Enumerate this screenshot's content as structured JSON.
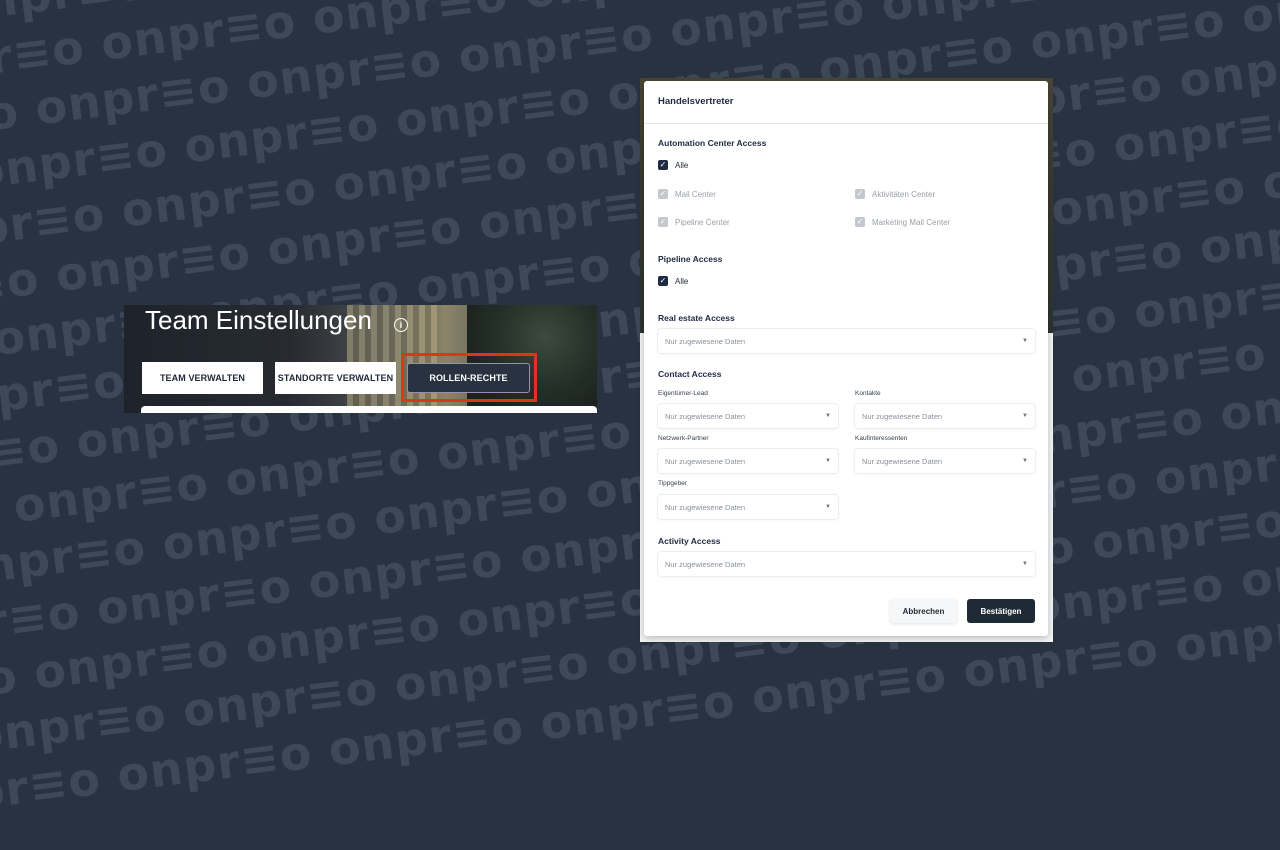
{
  "watermark": {
    "text": "onpr≡o"
  },
  "team_settings": {
    "title": "Team Einstellungen",
    "tabs": [
      {
        "label": "TEAM VERWALTEN"
      },
      {
        "label": "STANDORTE VERWALTEN"
      },
      {
        "label": "ROLLEN-RECHTE"
      }
    ]
  },
  "modal": {
    "title": "Handelsvertreter",
    "automation": {
      "title": "Automation Center Access",
      "all_label": "Alle",
      "items": [
        "Mail Center",
        "Aktivitäten Center",
        "Pipeline Center",
        "Marketing Mail Center"
      ]
    },
    "pipeline": {
      "title": "Pipeline Access",
      "all_label": "Alle"
    },
    "real_estate": {
      "title": "Real estate Access",
      "value": "Nur zugewiesene Daten"
    },
    "contact": {
      "title": "Contact Access",
      "fields": [
        {
          "label": "Eigentümer-Lead",
          "value": "Nur zugewiesene Daten"
        },
        {
          "label": "Kontakte",
          "value": "Nur zugewiesene Daten"
        },
        {
          "label": "Netzwerk-Partner",
          "value": "Nur zugewiesene Daten"
        },
        {
          "label": "Kaufinteressenten",
          "value": "Nur zugewiesene Daten"
        },
        {
          "label": "Tippgeber",
          "value": "Nur zugewiesene Daten"
        }
      ]
    },
    "activity": {
      "title": "Activity Access",
      "value": "Nur zugewiesene Daten"
    },
    "buttons": {
      "cancel": "Abbrechen",
      "confirm": "Bestätigen"
    }
  }
}
